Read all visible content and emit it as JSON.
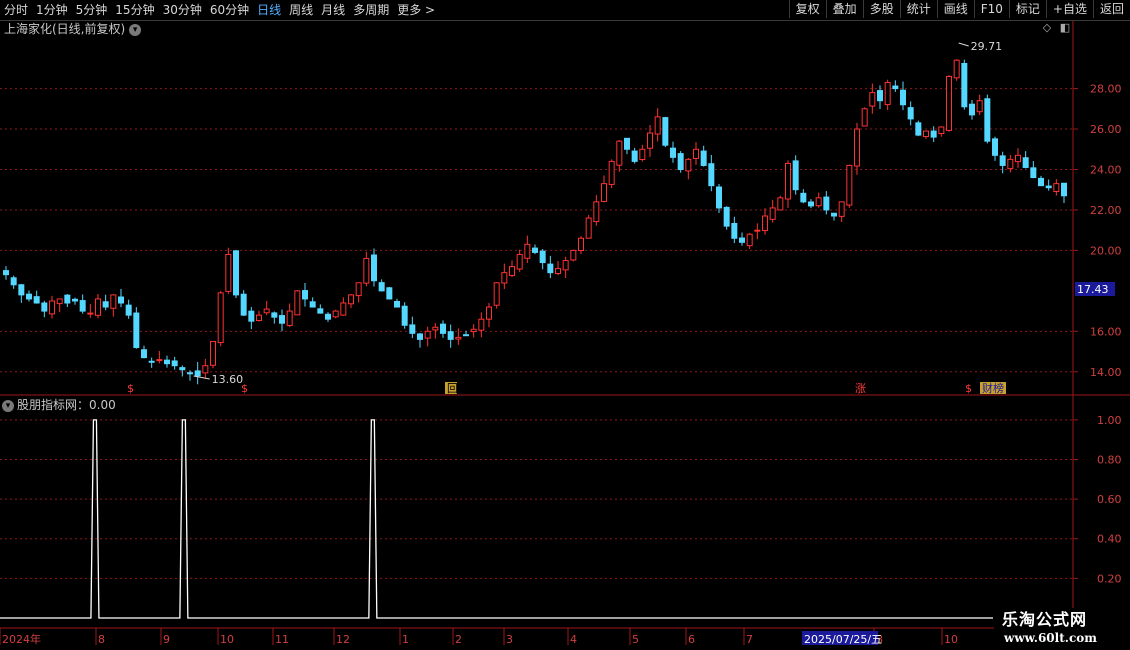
{
  "toolbar": {
    "periods": [
      "分时",
      "1分钟",
      "5分钟",
      "15分钟",
      "30分钟",
      "60分钟",
      "日线",
      "周线",
      "月线",
      "多周期",
      "更多 >"
    ],
    "active_period": "日线",
    "buttons": [
      "复权",
      "叠加",
      "多股",
      "统计",
      "画线",
      "F10",
      "标记",
      "+自选",
      "返回"
    ]
  },
  "main_chart": {
    "title": "上海家化(日线,前复权)",
    "price_axis_ticks": [
      "28.00",
      "26.00",
      "24.00",
      "22.00",
      "20.00",
      "16.00",
      "14.00"
    ],
    "current_price_label": "17.43",
    "high_label": "29.71",
    "low_label": "13.60",
    "event_markers": [
      "$",
      "$",
      "回",
      "涨",
      "$",
      "财榜"
    ]
  },
  "indicator": {
    "title": "股朋指标网：0.00",
    "axis_ticks": [
      "1.00",
      "0.80",
      "0.60",
      "0.40",
      "0.20"
    ]
  },
  "time_axis": {
    "labels": [
      "2024年",
      "8",
      "9",
      "10",
      "11",
      "12",
      "1",
      "2",
      "3",
      "4",
      "5",
      "6",
      "7",
      "8",
      "10"
    ],
    "cursor_date": "2025/07/25/五"
  },
  "watermark": {
    "line1": "乐淘公式网",
    "line2": "www.60lt.com"
  },
  "colors": {
    "up": "#ff3232",
    "down": "#54d8ff",
    "grid": "#8b1a1a",
    "axis_text": "#d04040",
    "indicator_line": "#ffffff",
    "cursor_box": "#1a1a9a"
  },
  "chart_data": {
    "type": "candlestick",
    "title": "上海家化(日线,前复权)",
    "ylim": [
      13.0,
      30.5
    ],
    "price_series": [
      18.8,
      18.3,
      17.8,
      17.6,
      17.4,
      17.0,
      17.5,
      17.6,
      17.4,
      17.5,
      17.0,
      16.9,
      17.6,
      17.2,
      17.8,
      17.4,
      16.8,
      15.2,
      14.7,
      14.5,
      14.6,
      14.4,
      14.3,
      14.1,
      13.9,
      13.8,
      14.3,
      15.5,
      17.9,
      19.8,
      17.8,
      16.8,
      16.5,
      16.8,
      17.1,
      16.7,
      16.4,
      17.0,
      18.0,
      17.6,
      17.2,
      16.9,
      16.6,
      17.0,
      17.4,
      17.8,
      18.4,
      19.6,
      18.5,
      18.0,
      17.6,
      17.2,
      16.3,
      15.9,
      15.6,
      16.0,
      16.2,
      15.9,
      15.6,
      15.7,
      15.8,
      16.1,
      16.6,
      17.2,
      18.4,
      18.9,
      19.2,
      19.8,
      20.3,
      19.9,
      19.4,
      18.9,
      19.1,
      19.5,
      20.0,
      20.6,
      21.6,
      22.4,
      23.3,
      24.4,
      25.4,
      25.0,
      24.4,
      25.0,
      25.8,
      26.6,
      25.2,
      24.6,
      24.0,
      24.5,
      25.0,
      24.2,
      23.2,
      22.1,
      21.2,
      20.6,
      20.4,
      20.8,
      21.0,
      21.7,
      22.1,
      22.6,
      24.3,
      23.0,
      22.4,
      22.2,
      22.6,
      22.0,
      21.7,
      22.4,
      24.2,
      26.0,
      27.0,
      27.8,
      27.4,
      28.3,
      28.0,
      27.2,
      26.5,
      25.7,
      25.9,
      25.6,
      26.1,
      28.6,
      29.4,
      27.1,
      26.7,
      27.4,
      25.4,
      24.7,
      24.2,
      24.5,
      24.7,
      24.1,
      23.6,
      23.2,
      23.1,
      23.3,
      22.7
    ],
    "indicator_values_peaks": [
      {
        "bar_index": 8,
        "value": 1.0
      },
      {
        "bar_index": 16,
        "value": 1.0
      },
      {
        "bar_index": 33,
        "value": 1.0
      }
    ],
    "indicator_ylim": [
      0.0,
      1.08
    ]
  }
}
